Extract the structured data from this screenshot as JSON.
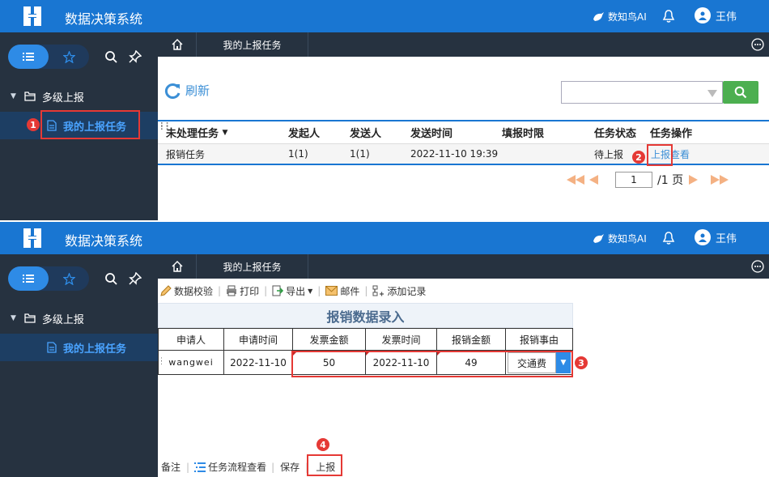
{
  "app": {
    "title": "数据决策系统",
    "ai_label": "数知鸟AI",
    "user_name": "王伟"
  },
  "sidebar": {
    "group_label": "多级上报",
    "item_label": "我的上报任务"
  },
  "tabs": {
    "active_tab": "我的上报任务"
  },
  "panel1": {
    "refresh_label": "刷新",
    "search": {
      "value": ""
    },
    "table": {
      "headers": [
        "未处理任务",
        "发起人",
        "发送人",
        "发送时间",
        "填报时限",
        "任务状态",
        "任务操作"
      ],
      "row": {
        "task": "报销任务",
        "initiator": "1(1)",
        "sender": "1(1)",
        "send_time": "2022-11-10 19:39",
        "deadline": "",
        "status": "待上报",
        "action_report": "上报",
        "action_view": "查看"
      }
    },
    "pager": {
      "page": "1",
      "total": "/1 页"
    },
    "markers": {
      "m1": "1",
      "m2": "2"
    }
  },
  "panel2": {
    "toolbar": {
      "validate": "数据校验",
      "print": "打印",
      "export": "导出",
      "mail": "邮件",
      "add_record": "添加记录"
    },
    "form": {
      "title": "报销数据录入",
      "headers": [
        "申请人",
        "申请时间",
        "发票金额",
        "发票时间",
        "报销金额",
        "报销事由"
      ],
      "row": {
        "applicant": "wangwei",
        "apply_time": "2022-11-10",
        "invoice_amount": "50",
        "invoice_time": "2022-11-10",
        "reimburse_amount": "49",
        "reason": "交通费"
      }
    },
    "bottom": {
      "note": "备注",
      "flow": "任务流程查看",
      "save": "保存",
      "report": "上报"
    },
    "markers": {
      "m3": "3",
      "m4": "4"
    }
  },
  "colors": {
    "primary": "#1976d2",
    "sidebar": "#263240",
    "active_item": "#1d3e63",
    "search_button": "#4caf50",
    "marker": "#e53935",
    "link": "#3b8fd6"
  }
}
